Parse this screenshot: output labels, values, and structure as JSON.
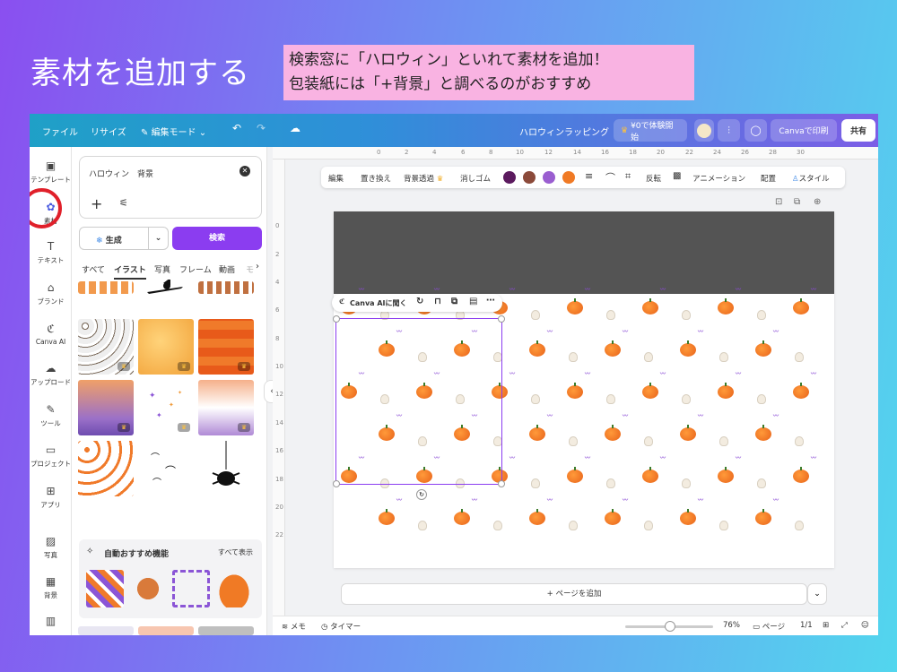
{
  "slide": {
    "title": "素材を追加する",
    "callout_line1": "検索窓に「ハロウィン」といれて素材を追加！",
    "callout_line2": "包装紙には「+背景」と調べるのがおすすめ"
  },
  "topbar": {
    "file": "ファイル",
    "resize": "リサイズ",
    "edit_mode": "編集モード",
    "doc_title": "ハロウィンラッピング",
    "trial": "¥0で体験開始",
    "print": "Canvaで印刷",
    "share": "共有"
  },
  "rail": {
    "templates": "テンプレート",
    "elements": "素材",
    "text": "テキスト",
    "brand": "ブランド",
    "canva_ai": "Canva AI",
    "uploads": "アップロード",
    "tools": "ツール",
    "projects": "プロジェクト",
    "apps": "アプリ",
    "photos": "写真",
    "background": "背景"
  },
  "panel": {
    "query": "ハロウィン　背景",
    "generate": "生成",
    "search_button": "検索",
    "filters": [
      "すべて",
      "イラスト",
      "写真",
      "フレーム",
      "動画",
      "モ"
    ],
    "active_filter": "イラスト",
    "section_title": "自動おすすめ機能",
    "see_all": "すべて表示"
  },
  "toolbar": {
    "edit": "編集",
    "replace": "置き換え",
    "bg_remove": "背景透過",
    "eraser": "消しゴム",
    "flip": "反転",
    "animate": "アニメーション",
    "position": "配置",
    "style": "スタイル",
    "swatches": [
      "#5b1a5e",
      "#8b4a3a",
      "#9a5ed0",
      "#f07a25"
    ]
  },
  "context_menu": {
    "ask_ai": "Canva AIに聞く"
  },
  "ruler": {
    "top": [
      "0",
      "2",
      "4",
      "6",
      "8",
      "10",
      "12",
      "14",
      "16",
      "18",
      "20",
      "22",
      "24",
      "26",
      "28",
      "30"
    ],
    "left": [
      "0",
      "2",
      "4",
      "6",
      "8",
      "10",
      "12",
      "14",
      "16",
      "18",
      "20",
      "22"
    ]
  },
  "canvas": {
    "add_page": "+ ページを追加"
  },
  "bottombar": {
    "notes": "メモ",
    "timer": "タイマー",
    "zoom": "76%",
    "pages_label": "ページ",
    "page_count": "1/1"
  }
}
